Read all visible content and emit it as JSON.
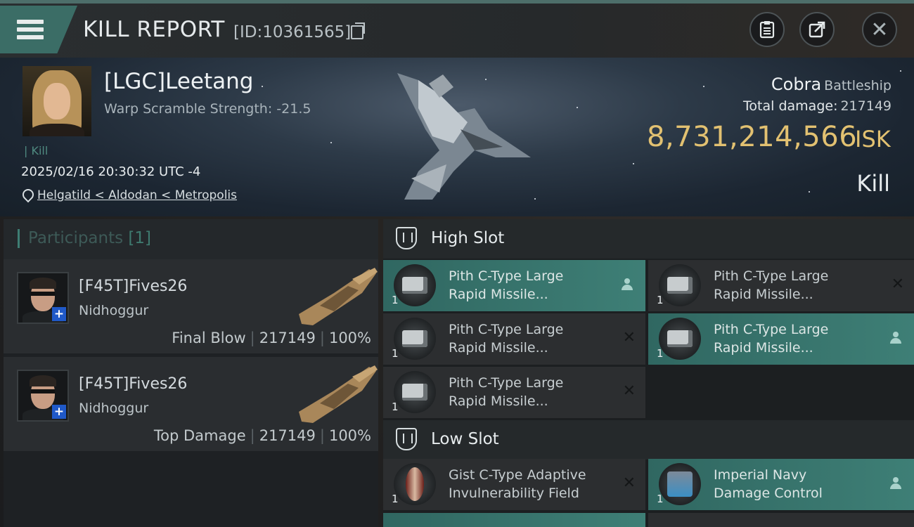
{
  "header": {
    "title": "KILL REPORT",
    "report_id": "[ID:10361565]"
  },
  "victim": {
    "pilot": "[LGC]Leetang",
    "warp_scramble": "Warp Scramble Strength: -21.5",
    "kill_tag": "| Kill",
    "timestamp": "2025/02/16 20:30:32 UTC -4",
    "location": "Helgatild < Aldodan < Metropolis",
    "ship_name": "Cobra",
    "ship_class": "Battleship",
    "total_damage_label": "Total damage:",
    "total_damage": "217149",
    "isk_value": "8,731,214,566",
    "isk_unit": "ISK",
    "result": "Kill"
  },
  "participants": {
    "title": "Participants",
    "count": "[1]",
    "rows": [
      {
        "name": "[F45T]Fives26",
        "ship": "Nidhoggur",
        "role": "Final Blow",
        "damage": "217149",
        "percent": "100%"
      },
      {
        "name": "[F45T]Fives26",
        "ship": "Nidhoggur",
        "role": "Top Damage",
        "damage": "217149",
        "percent": "100%"
      }
    ]
  },
  "fitting": {
    "high_slot_title": "High Slot",
    "low_slot_title": "Low Slot",
    "high_modules": [
      {
        "line1": "Pith C-Type Large",
        "line2": "Rapid Missile...",
        "qty": "1",
        "state": "dropped"
      },
      {
        "line1": "Pith C-Type Large",
        "line2": "Rapid Missile...",
        "qty": "1",
        "state": "destroyed"
      },
      {
        "line1": "Pith C-Type Large",
        "line2": "Rapid Missile...",
        "qty": "1",
        "state": "destroyed"
      },
      {
        "line1": "Pith C-Type Large",
        "line2": "Rapid Missile...",
        "qty": "1",
        "state": "dropped"
      },
      {
        "line1": "Pith C-Type Large",
        "line2": "Rapid Missile...",
        "qty": "1",
        "state": "destroyed"
      }
    ],
    "low_modules": [
      {
        "line1": "Gist C-Type Adaptive",
        "line2": "Invulnerability Field",
        "qty": "1",
        "state": "destroyed"
      },
      {
        "line1": "Imperial Navy",
        "line2": "Damage Control",
        "qty": "1",
        "state": "dropped"
      }
    ]
  },
  "colors": {
    "accent": "#3e7f76",
    "isk": "#e2c171",
    "destroyed_mark": "#141617"
  }
}
